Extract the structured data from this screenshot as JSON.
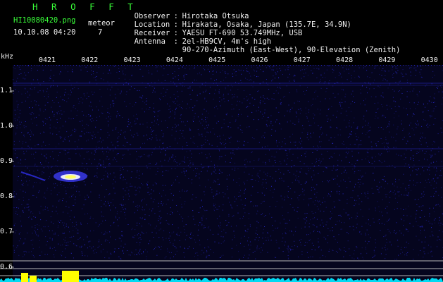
{
  "header": {
    "brand": "H R O F F T",
    "filename": "HI10080420.png",
    "meteor_label": "meteor",
    "meteor_count": "7",
    "datetime": "10.10.08 04:20"
  },
  "station": {
    "observer_label": "Observer",
    "observer": "Hirotaka Otsuka",
    "location_label": "Location",
    "location": "Hirakata, Osaka, Japan (135.7E, 34.9N)",
    "receiver_label": "Receiver",
    "receiver": "YAESU FT-690 53.749MHz, USB",
    "antenna_label": "Antenna",
    "antenna_line1": "2el-HB9CV, 4m's high",
    "antenna_line2": "90-270-Azimuth (East-West), 90-Elevation (Zenith)",
    "separator": ":"
  },
  "chart_data": {
    "type": "heatmap",
    "yunit": "kHz",
    "x_tick_labels": [
      "0421",
      "0422",
      "0423",
      "0424",
      "0425",
      "0426",
      "0427",
      "0428",
      "0429",
      "0430"
    ],
    "y_tick_labels": [
      "1.1",
      "1.0",
      "0.9",
      "0.8",
      "0.7",
      "0.6"
    ],
    "y_values": [
      1.1,
      1.0,
      0.9,
      0.8,
      0.7,
      0.6
    ],
    "ylim": [
      0.59,
      1.2
    ],
    "background_color": "#05051e",
    "noise_color": "#2a2ad0",
    "echo_color": "#ffff60",
    "hline_color": "#b8b8b8",
    "bottom_meter_color": "#ffff00",
    "bottom_trace_color": "#00e6ff"
  }
}
